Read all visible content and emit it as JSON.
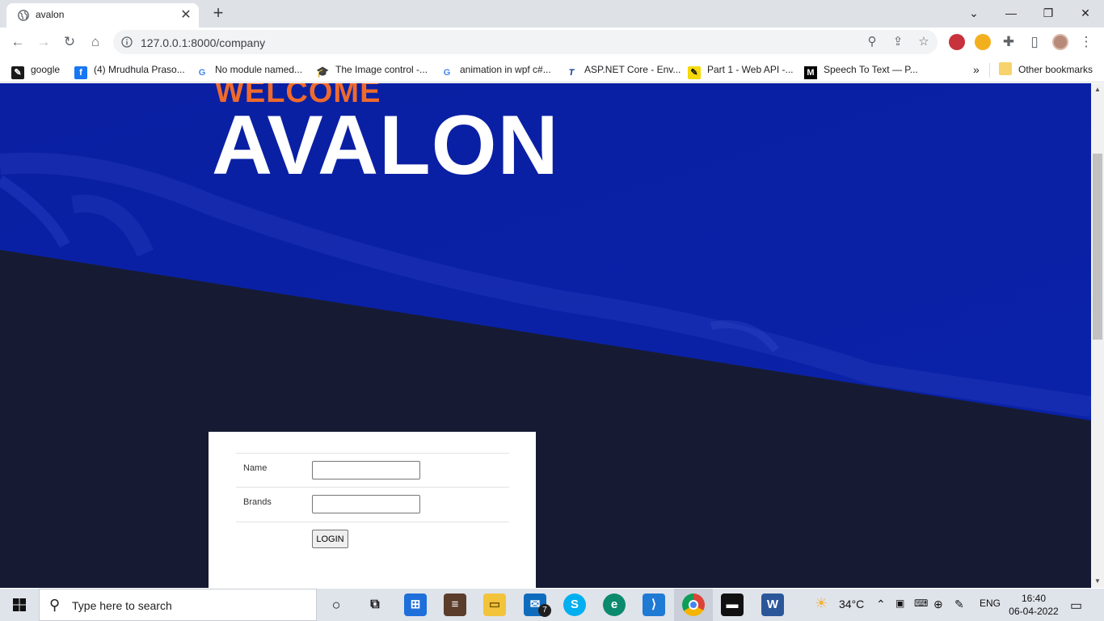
{
  "browser": {
    "tab_title": "avalon",
    "url": "127.0.0.1:8000/company",
    "bookmarks": [
      {
        "label": "google",
        "icon": "bookmark-icon"
      },
      {
        "label": "(4) Mrudhula Praso...",
        "icon": "facebook-icon"
      },
      {
        "label": "No module named...",
        "icon": "google-icon"
      },
      {
        "label": "The Image control -...",
        "icon": "mortarboard-icon"
      },
      {
        "label": "animation in wpf c#...",
        "icon": "google-icon"
      },
      {
        "label": "ASP.NET Core - Env...",
        "icon": "tutorialsteacher-icon"
      },
      {
        "label": "Part 1 - Web API -...",
        "icon": "pencil-icon"
      },
      {
        "label": "Speech To Text — P...",
        "icon": "medium-icon"
      }
    ],
    "more_bookmarks": "»",
    "other_bookmarks": "Other bookmarks"
  },
  "page": {
    "welcome": "WELCOME",
    "brand": "AVALON",
    "form": {
      "name_label": "Name",
      "name_value": "",
      "brands_label": "Brands",
      "brands_value": "",
      "login_label": "LOGIN"
    },
    "colors": {
      "hero_blue": "#0a1f9e",
      "dark_navy": "#161b33",
      "welcome_orange": "#ee6b2d"
    }
  },
  "taskbar": {
    "search_placeholder": "Type here to search",
    "mail_badge": "7",
    "weather": "34°C",
    "language": "ENG",
    "time": "16:40",
    "date": "06-04-2022"
  }
}
